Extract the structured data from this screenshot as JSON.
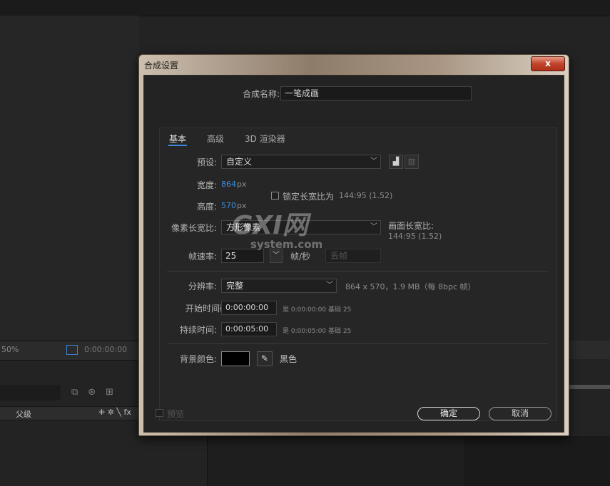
{
  "background": {
    "zoom": "50%",
    "timecode": "0:00:00:00",
    "layer_header_label": "父级",
    "switches_glyphs": "⁜ ✲ ╲ fx"
  },
  "dialog": {
    "title": "合成设置",
    "close_glyph": "x",
    "comp_name_label": "合成名称:",
    "comp_name_value": "一笔成画",
    "tabs": [
      {
        "label": "基本",
        "active": true
      },
      {
        "label": "高级",
        "active": false
      },
      {
        "label": "3D 渲染器",
        "active": false
      }
    ],
    "preset": {
      "label": "预设:",
      "value": "自定义"
    },
    "width": {
      "label": "宽度:",
      "value": "864",
      "unit": "px"
    },
    "height": {
      "label": "高度:",
      "value": "570",
      "unit": "px"
    },
    "lock_aspect": {
      "label": "锁定长宽比为",
      "value": "144:95 (1.52)",
      "checked": false
    },
    "pixel_aspect": {
      "label": "像素长宽比:",
      "value": "方形像素"
    },
    "frame_aspect": {
      "label": "画面长宽比:",
      "value": "144:95 (1.52)"
    },
    "frame_rate": {
      "label": "帧速率:",
      "value": "25",
      "unit": "帧/秒",
      "drop_frame": "丢帧"
    },
    "resolution": {
      "label": "分辨率:",
      "value": "完整",
      "info": "864 x 570，1.9 MB（每 8bpc 帧）"
    },
    "start_timecode": {
      "label": "开始时间码:",
      "value": "0:00:00:00",
      "note": "是 0:00:00:00",
      "base": "基础 25"
    },
    "duration": {
      "label": "持续时间:",
      "value": "0:00:05:00",
      "note": "是 0:00:05:00",
      "base": "基础 25"
    },
    "bg_color": {
      "label": "背景颜色:",
      "name": "黑色",
      "swatch": "#000000"
    },
    "preview_label": "预览",
    "ok_label": "确定",
    "cancel_label": "取消"
  },
  "watermark": {
    "line1": "GXI网",
    "line2": "system.com"
  },
  "colors": {
    "accent": "#3c8ae0",
    "close": "#c0432b"
  }
}
